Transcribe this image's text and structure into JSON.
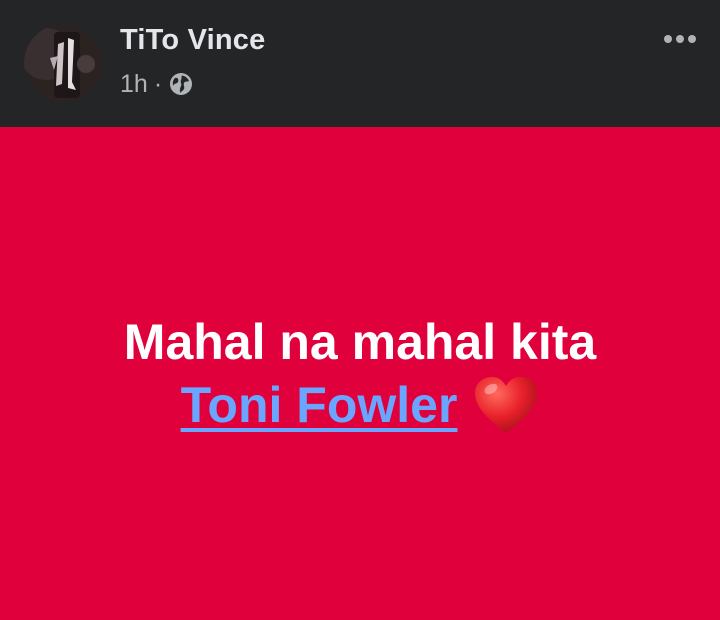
{
  "post": {
    "author_name": "TiTo Vince",
    "timestamp": "1h",
    "separator": "·",
    "privacy_icon": "globe-icon",
    "more_icon": "more-horizontal-icon",
    "text_line1": "Mahal na mahal kita",
    "mention": "Toni Fowler",
    "emoji": "red-heart-emoji"
  },
  "colors": {
    "header_bg": "#242526",
    "name_text": "#e4e6eb",
    "meta_text": "#b0b3b8",
    "post_background": "#e0003c",
    "post_text": "#ffffff",
    "mention_link": "#6aa6ff"
  }
}
